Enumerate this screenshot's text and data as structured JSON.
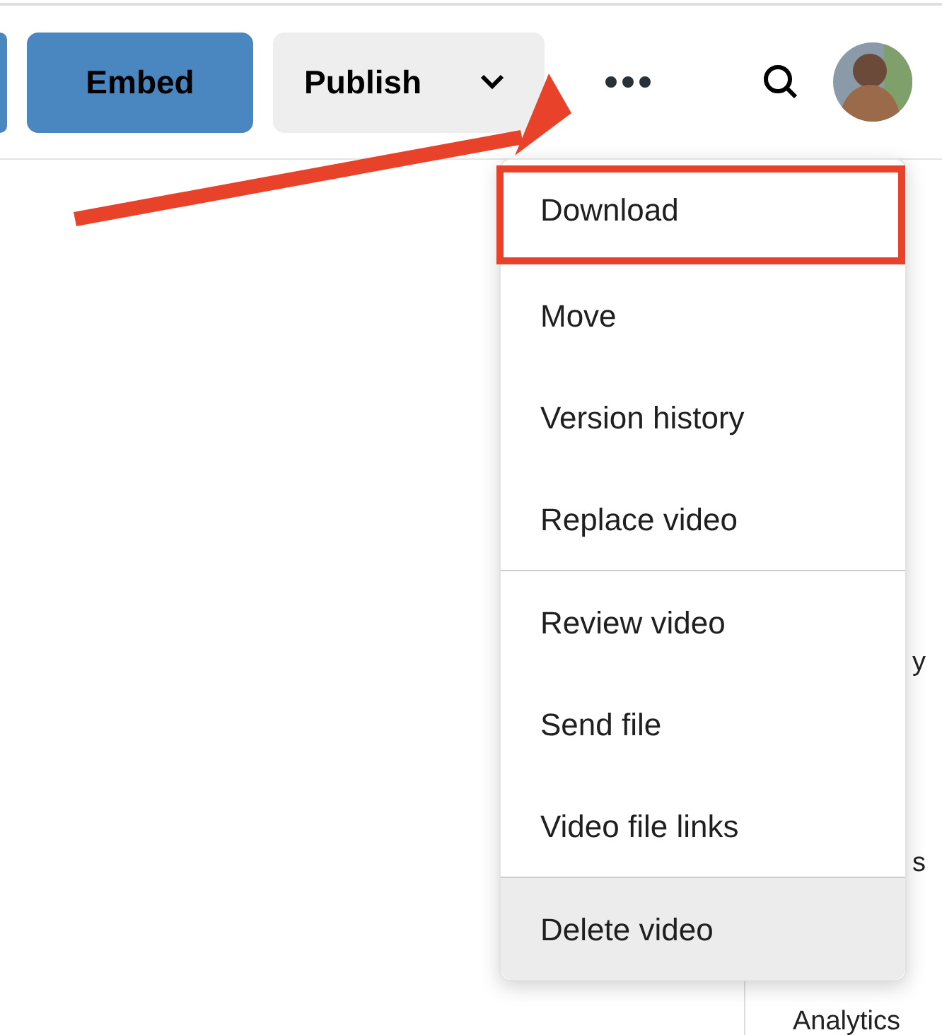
{
  "toolbar": {
    "buttons": [
      {
        "label": "Embed",
        "kind": "primary"
      },
      {
        "label": "Publish",
        "kind": "dropdown"
      }
    ]
  },
  "menu": {
    "sections": [
      {
        "items": [
          {
            "label": "Download",
            "highlighted": false,
            "annotated": true
          },
          {
            "label": "Move",
            "highlighted": false,
            "annotated": false
          },
          {
            "label": "Version history",
            "highlighted": false,
            "annotated": false
          },
          {
            "label": "Replace video",
            "highlighted": false,
            "annotated": false
          }
        ]
      },
      {
        "items": [
          {
            "label": "Review video",
            "highlighted": false,
            "annotated": false
          },
          {
            "label": "Send file",
            "highlighted": false,
            "annotated": false
          },
          {
            "label": "Video file links",
            "highlighted": false,
            "annotated": false
          }
        ]
      },
      {
        "items": [
          {
            "label": "Delete video",
            "highlighted": true,
            "annotated": false
          }
        ]
      }
    ]
  },
  "side_panel": {
    "labels": [
      "y",
      "s"
    ],
    "footer": "Analytics"
  }
}
